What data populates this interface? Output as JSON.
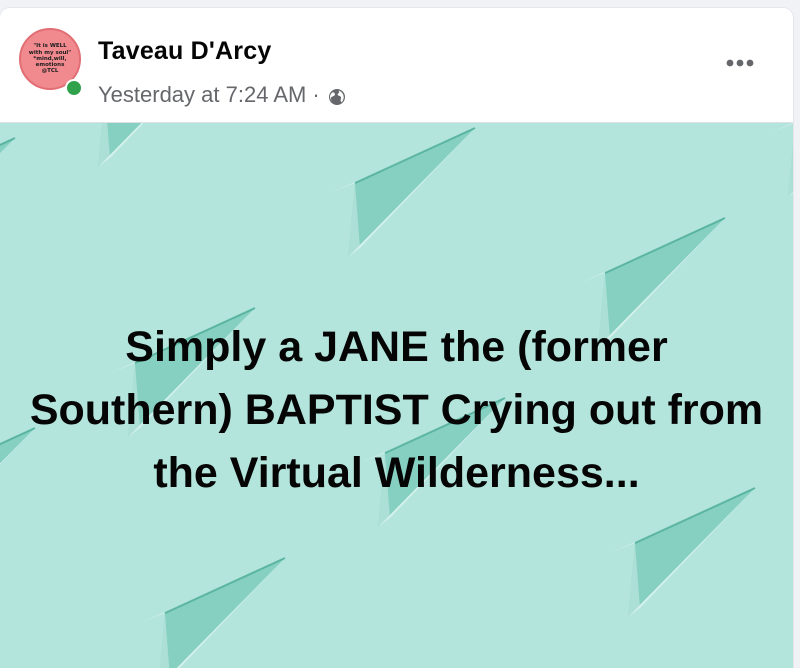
{
  "post": {
    "author": "Taveau D'Arcy",
    "timestamp": "Yesterday at 7:24 AM",
    "separator": "·",
    "audience_icon": "globe-icon",
    "menu_icon": "more-horizontal-icon",
    "avatar_text": "\"It is WELL with my soul\" *mind,will, emotions @TCL",
    "online_status_color": "#31a24c",
    "body_text": "Simply a JANE the (former Southern) BAPTIST Crying out from the Virtual Wilderness...",
    "background_color": "#b3e5dc",
    "background_pattern": "paper-plane-pattern"
  }
}
